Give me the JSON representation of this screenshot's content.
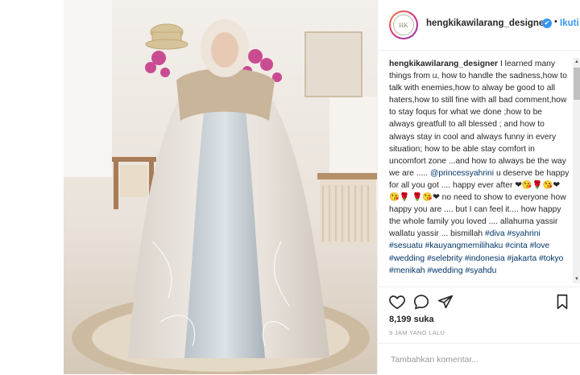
{
  "header": {
    "username": "hengkikawilarang_designer",
    "verified_glyph": "✔",
    "separator": "•",
    "follow_label": "Ikuti"
  },
  "caption": {
    "username": "hengkikawilarang_designer",
    "text_1": "I learned many things from u, how to handle the sadness,how to talk with enemies,how to alway be good to all haters,how to still fine with all bad comment,how to stay foqus for what we done ;how to be always greatfull to all blessed ; and how to always stay in cool and always funny in every situation; how to be able stay comfort in uncomfort zone ...and how to always be the way we are ..... ",
    "mention": "@princessyahrini",
    "text_2": " u deserve be happy for all you got .... happy ever after ",
    "emoji_1": "❤😘🌹😘❤😘🌹",
    "emoji_2": "🌹😘❤",
    "text_3": " no need to show to everyone how happy you are .... but I can feel it.... how happy the whole family you loved .... allahuma yassir wallatu yassir ... bismillah",
    "hashtags": "#diva #syahrini #sesuatu #kauyangmemilihaku #cinta #love #wedding #selebrity #indonesia #jakarta #tokyo #menikah #wedding #syahdu"
  },
  "actions": {
    "like_icon": "heart-icon",
    "comment_icon": "comment-icon",
    "share_icon": "share-icon",
    "save_icon": "bookmark-icon"
  },
  "likes": "8,199 suka",
  "time": "9 JAM YANG LALU",
  "comment_input": {
    "placeholder": "Tambahkan komentar..."
  },
  "avatar": {
    "mark_text": "HK"
  },
  "colors": {
    "accent": "#3897f0",
    "hashtag": "#003569",
    "muted": "#999999"
  }
}
